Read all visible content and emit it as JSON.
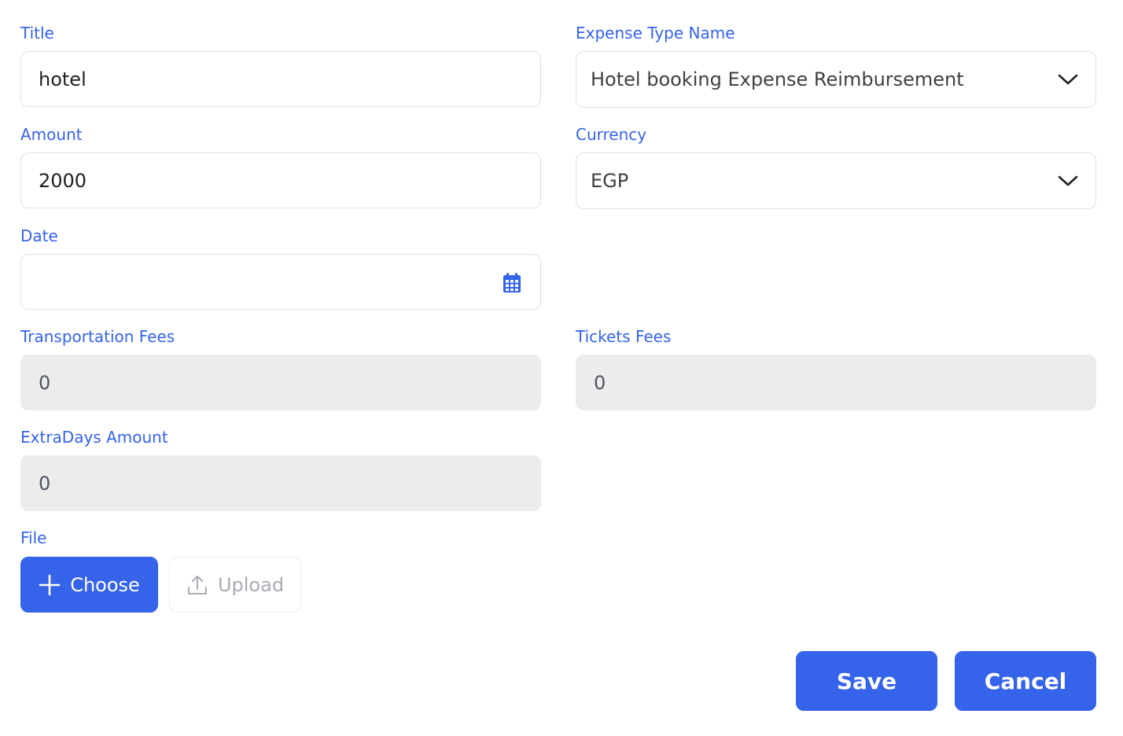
{
  "form": {
    "title": {
      "label": "Title",
      "value": "hotel"
    },
    "expense_type": {
      "label": "Expense Type Name",
      "value": "Hotel booking Expense Reimbursement"
    },
    "amount": {
      "label": "Amount",
      "value": "2000"
    },
    "currency": {
      "label": "Currency",
      "value": "EGP"
    },
    "date": {
      "label": "Date",
      "value": ""
    },
    "transportation_fees": {
      "label": "Transportation Fees",
      "value": "0"
    },
    "tickets_fees": {
      "label": "Tickets Fees",
      "value": "0"
    },
    "extra_days_amount": {
      "label": "ExtraDays Amount",
      "value": "0"
    },
    "file": {
      "label": "File",
      "choose_label": "Choose",
      "upload_label": "Upload"
    }
  },
  "actions": {
    "save_label": "Save",
    "cancel_label": "Cancel"
  },
  "icons": {
    "chevron": "chevron-down-icon",
    "calendar": "calendar-icon",
    "plus": "plus-icon",
    "upload": "upload-icon"
  },
  "colors": {
    "accent": "#3563e9",
    "disabled_bg": "#ececec",
    "border": "#dfe1e6"
  }
}
